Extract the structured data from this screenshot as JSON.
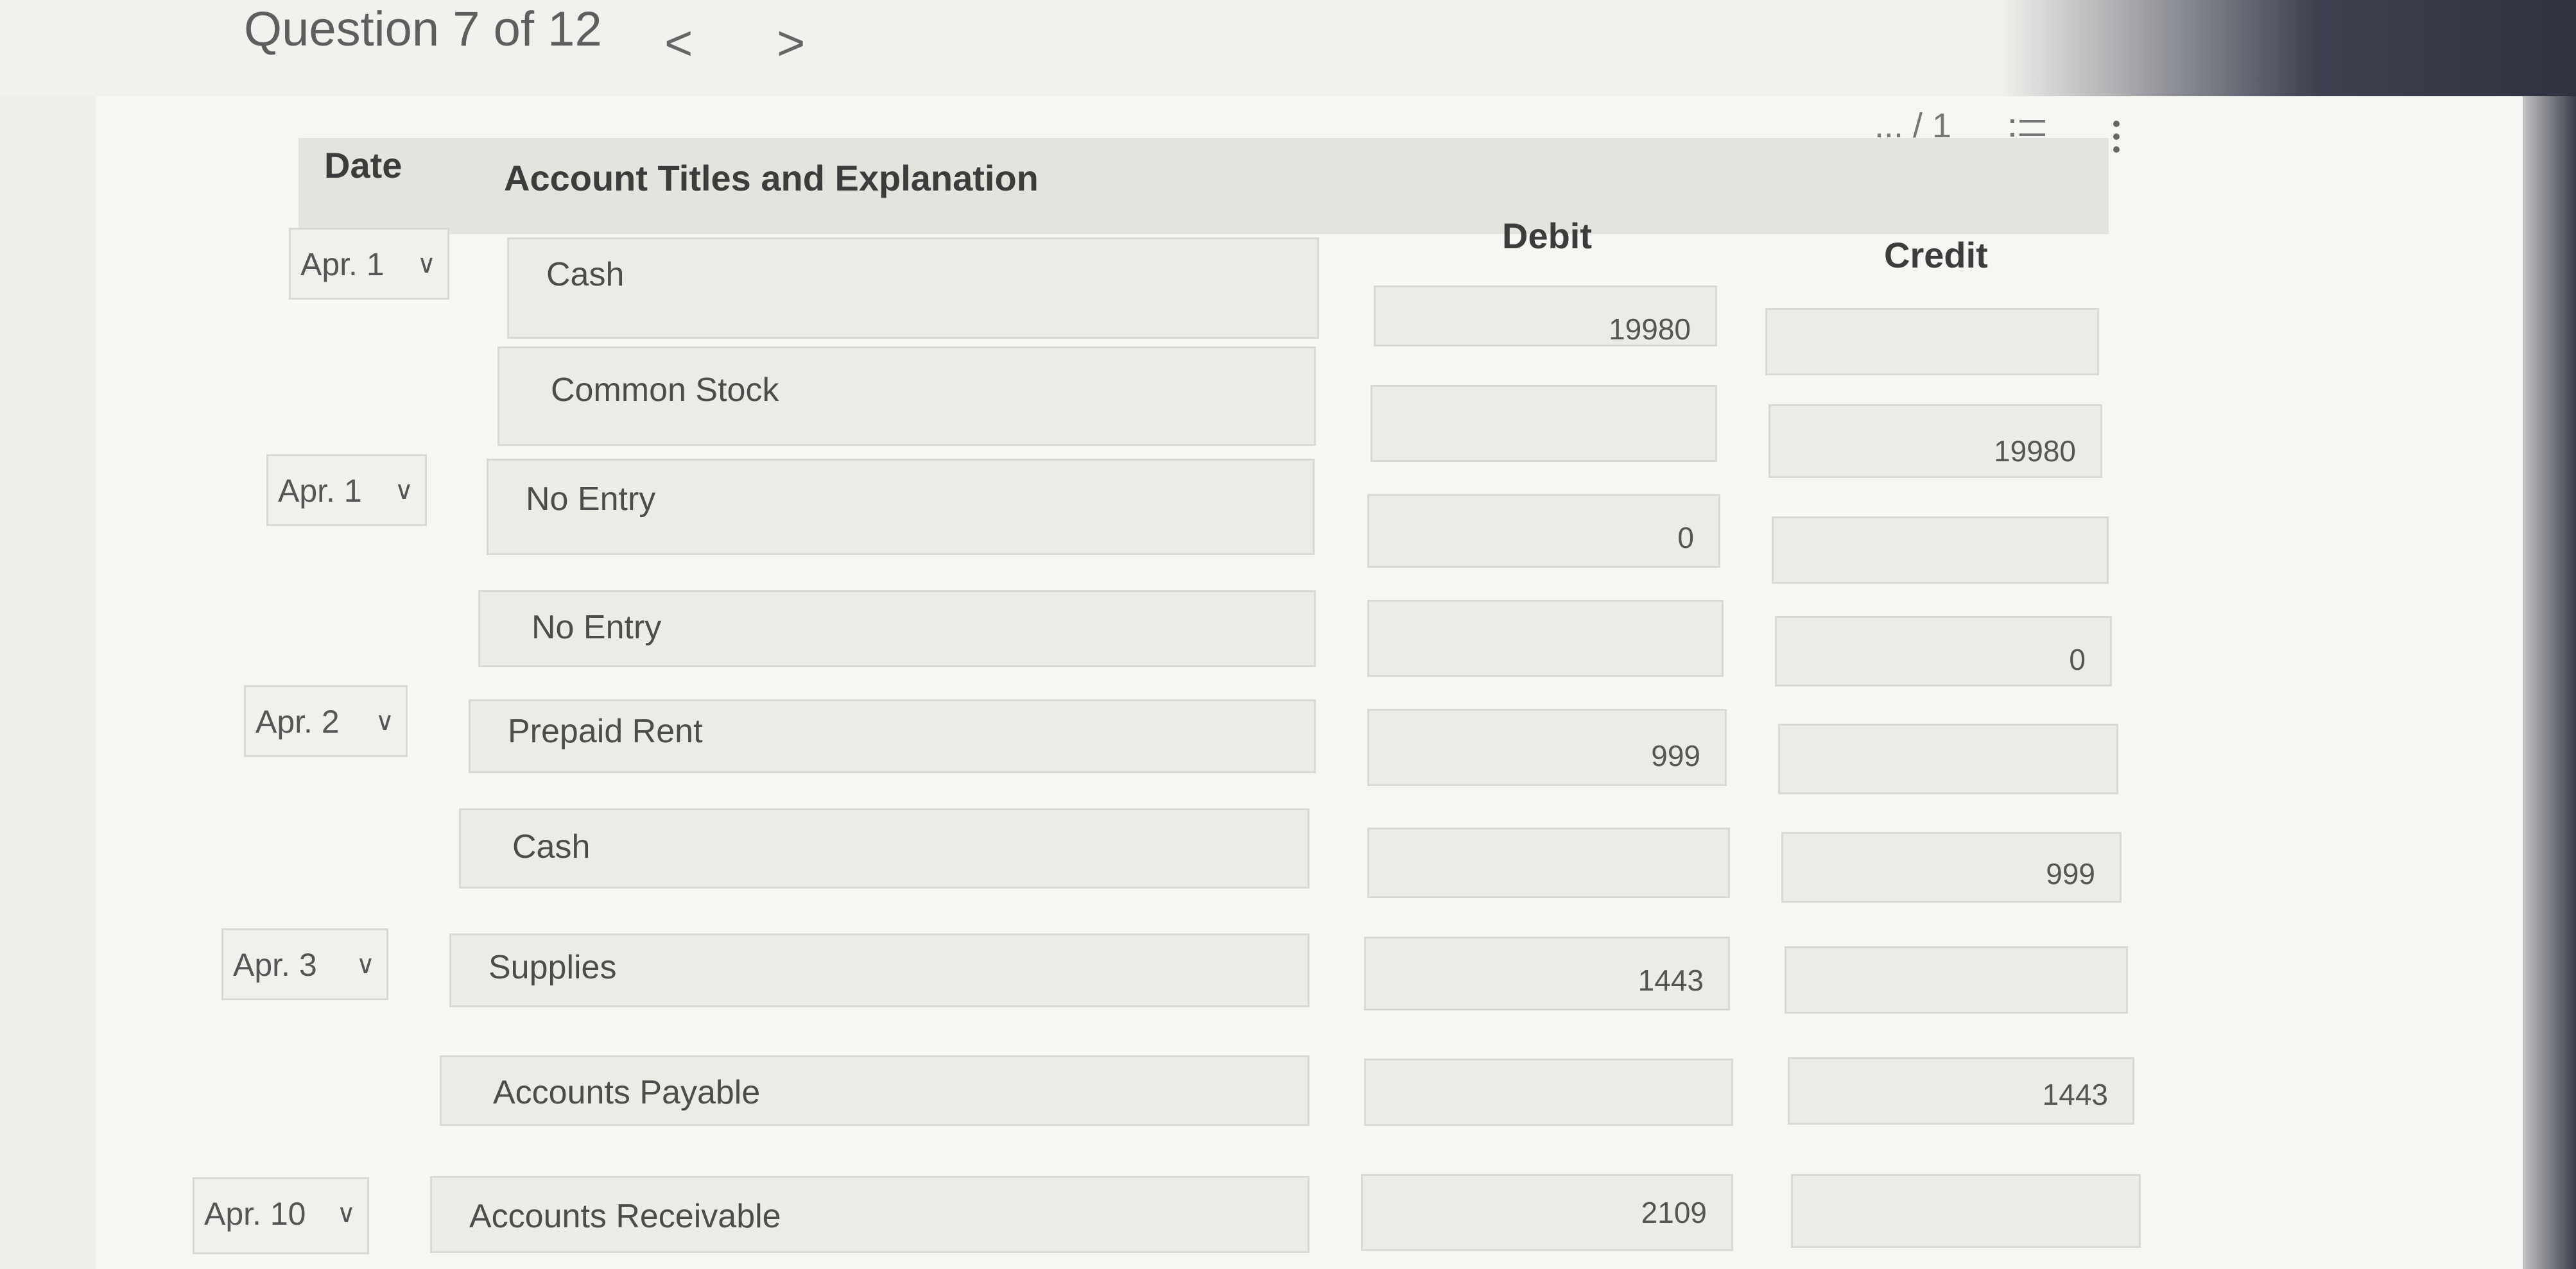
{
  "header": {
    "question": "Question 7 of 12",
    "prev": "<",
    "next": ">",
    "score": "... / 1"
  },
  "table": {
    "headers": {
      "date": "Date",
      "account": "Account Titles and Explanation",
      "debit": "Debit",
      "credit": "Credit"
    },
    "rows": [
      {
        "date": "Apr. 1",
        "account": "Cash",
        "debit": "19980",
        "credit": ""
      },
      {
        "date": "",
        "account": "Common Stock",
        "debit": "",
        "credit": "19980"
      },
      {
        "date": "Apr. 1",
        "account": "No Entry",
        "debit": "0",
        "credit": ""
      },
      {
        "date": "",
        "account": "No Entry",
        "debit": "",
        "credit": "0"
      },
      {
        "date": "Apr. 2",
        "account": "Prepaid Rent",
        "debit": "999",
        "credit": ""
      },
      {
        "date": "",
        "account": "Cash",
        "debit": "",
        "credit": "999"
      },
      {
        "date": "Apr. 3",
        "account": "Supplies",
        "debit": "1443",
        "credit": ""
      },
      {
        "date": "",
        "account": "Accounts Payable",
        "debit": "",
        "credit": "1443"
      },
      {
        "date": "Apr. 10",
        "account": "Accounts Receivable",
        "debit": "2109",
        "credit": ""
      }
    ]
  },
  "icons": {
    "list": "numbered-list-icon",
    "more": "vertical-ellipsis-icon",
    "chevron": "chevron-down-icon"
  }
}
